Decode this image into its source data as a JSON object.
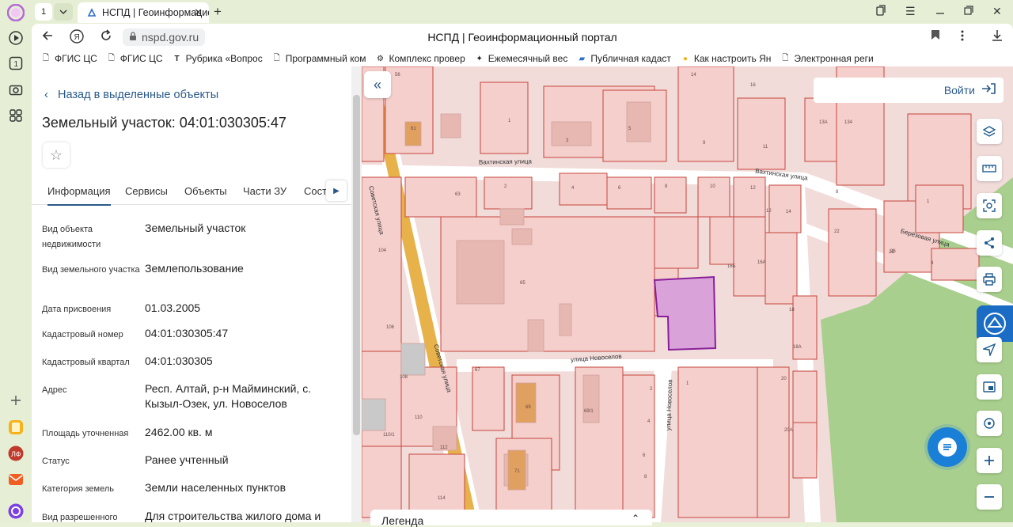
{
  "browser": {
    "tab_count": "1",
    "tab_title": "НСПД | Геоинформационный портал",
    "url": "nspd.gov.ru",
    "page_title": "НСПД | Геоинформационный портал",
    "bookmarks": [
      {
        "label": "ФГИС ЦС",
        "icon": "doc-icon"
      },
      {
        "label": "ФГИС ЦС",
        "icon": "doc-icon"
      },
      {
        "label": "Рубрика «Вопрос",
        "icon": "t-icon"
      },
      {
        "label": "Программный ком",
        "icon": "doc-icon"
      },
      {
        "label": "Комплекс провер",
        "icon": "gear-icon"
      },
      {
        "label": "Ежемесячный вес",
        "icon": "badge-icon"
      },
      {
        "label": "Публичная кадаст",
        "icon": "map-icon"
      },
      {
        "label": "Как настроить Ян",
        "icon": "circle-icon"
      },
      {
        "label": "Электронная реги",
        "icon": "doc-icon"
      }
    ]
  },
  "panel": {
    "back_label": "Назад в выделенные объекты",
    "title": "Земельный участок: 04:01:030305:47",
    "tabs": [
      "Информация",
      "Сервисы",
      "Объекты",
      "Части ЗУ",
      "Соста"
    ],
    "fields": [
      {
        "label": "Вид объекта недвижимости",
        "value": "Земельный участок"
      },
      {
        "label": "Вид земельного участка",
        "value": "Землепользование"
      },
      {
        "label": "Дата присвоения",
        "value": "01.03.2005"
      },
      {
        "label": "Кадастровый номер",
        "value": "04:01:030305:47"
      },
      {
        "label": "Кадастровый квартал",
        "value": "04:01:030305"
      },
      {
        "label": "Адрес",
        "value": "Респ. Алтай, р-н Майминский, с. Кызыл-Озек, ул. Новоселов"
      },
      {
        "label": "Площадь уточненная",
        "value": "2462.00 кв. м"
      },
      {
        "label": "Статус",
        "value": "Ранее учтенный"
      },
      {
        "label": "Категория земель",
        "value": "Земли населенных пунктов"
      },
      {
        "label": "Вид разрешенного",
        "value": "Для строительства жилого дома и"
      }
    ]
  },
  "map": {
    "login_label": "Войти",
    "legend_label": "Легенда",
    "streets": [
      "Вахтинская улица",
      "Вахтинская улица",
      "Советская улица",
      "Советская улица",
      "улица Новоселов",
      "улица Новоселов",
      "Берёзовая улица"
    ],
    "parcel_numbers": [
      "56",
      "61",
      "1",
      "3",
      "5",
      "9",
      "11",
      "13А",
      "14",
      "14",
      "16",
      "2",
      "4",
      "6",
      "8",
      "10",
      "12",
      "14",
      "22",
      "26",
      "63",
      "65",
      "16Б",
      "16А",
      "18",
      "18А",
      "20",
      "20А",
      "67",
      "69",
      "69/1",
      "71",
      "104",
      "106",
      "108",
      "110",
      "110/1",
      "112",
      "114",
      "1",
      "2",
      "4",
      "6",
      "8",
      "1",
      "2Б",
      "2",
      "4",
      "28",
      "8"
    ],
    "selected_color": "#d9a3d9",
    "parcel_color": "#f4cfcc",
    "parcel_stroke": "#c8443c",
    "road_color": "#e8b24a",
    "forest_color": "#a9cf8e"
  }
}
